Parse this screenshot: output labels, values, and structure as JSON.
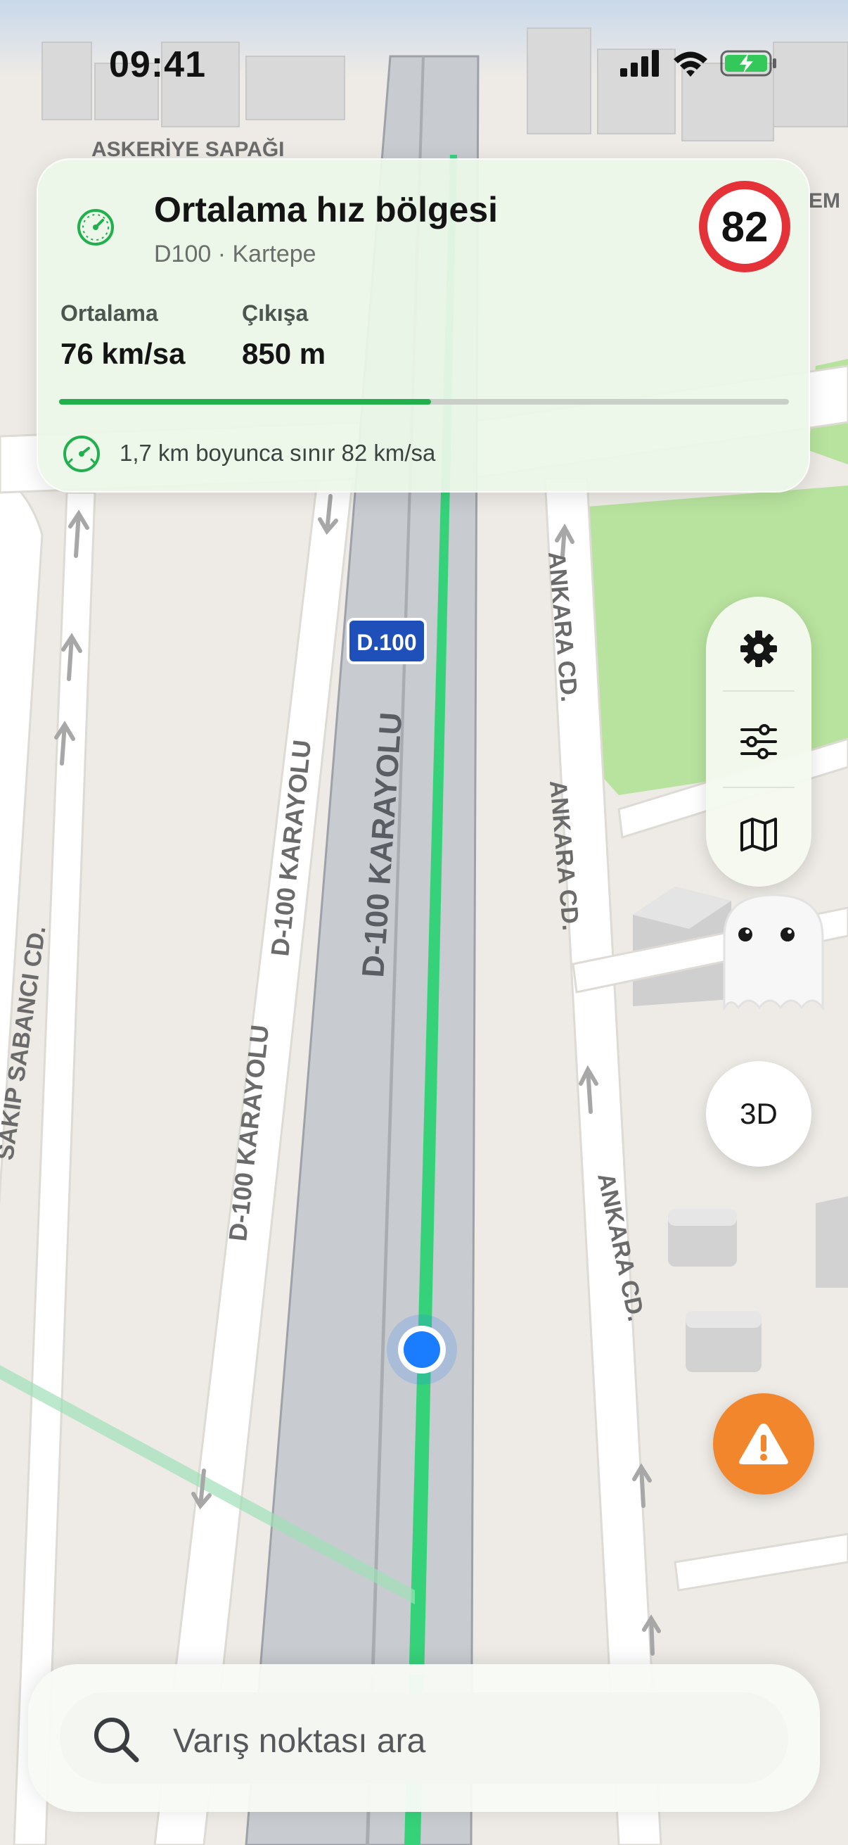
{
  "status_bar": {
    "time": "09:41"
  },
  "map": {
    "labels": {
      "top_junction": "ASKERİYE SAPAĞI",
      "top_right_partial": "EM",
      "route_shield": "D.100",
      "highway_main": "D-100 KARAYOLU",
      "highway_side_upper": "D-100 KARAYOLU",
      "highway_side_lower": "D-100 KARAYOLU",
      "street_left": "SAKIP SABANCI CD.",
      "street_right_1": "ANKARA CD.",
      "street_right_2": "ANKARA CD.",
      "street_right_3": "ANKARA CD."
    },
    "route_color": "#36d27a",
    "location_dot_color": "#1a7cff"
  },
  "zone_card": {
    "icon": "speedometer-icon",
    "title": "Ortalama hız bölgesi",
    "subtitle": "D100 · Kartepe",
    "speed_limit": "82",
    "average_label": "Ortalama",
    "average_value": "76 km/sa",
    "exit_label": "Çıkışa",
    "exit_value": "850 m",
    "progress_percent": 51,
    "limit_text": "1,7 km boyunca sınır 82 km/sa",
    "accent_color": "#22b04f",
    "sign_border_color": "#e53238"
  },
  "controls": {
    "settings_icon": "gear-icon",
    "filters_icon": "sliders-icon",
    "map_layers_icon": "map-icon",
    "view_toggle_label": "3D",
    "report_icon": "warning-icon",
    "report_color": "#f2862d"
  },
  "search": {
    "placeholder": "Varış noktası ara",
    "icon": "search-icon"
  }
}
